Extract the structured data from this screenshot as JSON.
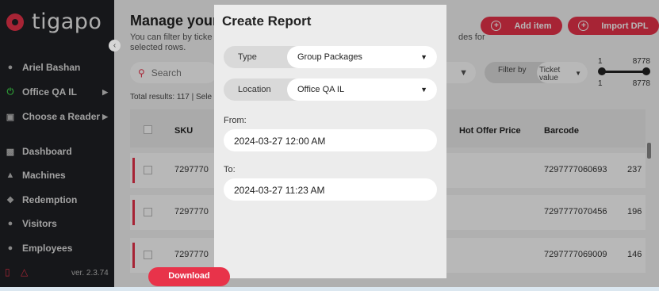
{
  "app": {
    "logo_text": "tigapo",
    "version": "ver. 2.3.74"
  },
  "sidebar": {
    "user": "Ariel Bashan",
    "location": "Office QA IL",
    "reader": "Choose a Reader",
    "items": [
      {
        "label": "Dashboard",
        "icon": "chart-icon"
      },
      {
        "label": "Machines",
        "icon": "joystick-icon"
      },
      {
        "label": "Redemption",
        "icon": "gift-icon"
      },
      {
        "label": "Visitors",
        "icon": "users-icon"
      },
      {
        "label": "Employees",
        "icon": "employee-icon"
      }
    ]
  },
  "main": {
    "title": "Manage your",
    "desc_left": "You can filter by ticke",
    "desc_right": "des for",
    "desc_line2": "selected rows.",
    "add_item": "Add item",
    "import_dpl": "Import DPL",
    "search_placeholder": "Search",
    "filter_by": "Filter by",
    "ticket_value": "Ticket value",
    "range_min": "1",
    "range_max": "8778",
    "total": "Total results: 117 | Sele",
    "columns": {
      "sku": "SKU",
      "hot_offer": "Hot Offer Price",
      "barcode": "Barcode"
    },
    "rows": [
      {
        "sku": "7297770",
        "barcode": "7297777060693",
        "extra": "237"
      },
      {
        "sku": "7297770",
        "barcode": "7297777070456",
        "extra": "196"
      },
      {
        "sku": "7297770",
        "barcode": "7297777069009",
        "extra": "146"
      }
    ]
  },
  "modal": {
    "title": "Create Report",
    "type_label": "Type",
    "type_value": "Group Packages",
    "location_label": "Location",
    "location_value": "Office QA IL",
    "from_label": "From:",
    "from_value": "2024-03-27 12:00 AM",
    "to_label": "To:",
    "to_value": "2024-03-27 11:23 AM",
    "download": "Download"
  },
  "colors": {
    "accent": "#e8334a",
    "sidebar_bg": "#1f2024"
  }
}
